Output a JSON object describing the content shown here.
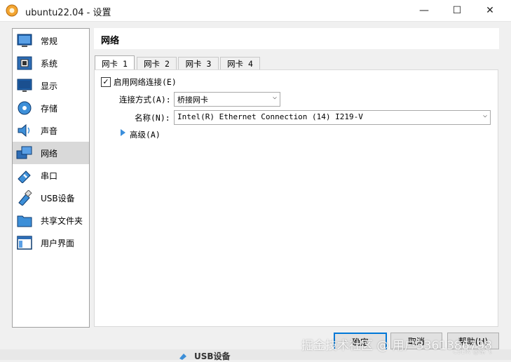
{
  "window": {
    "title": "ubuntu22.04 - 设置",
    "minimize_glyph": "—",
    "maximize_glyph": "☐",
    "close_glyph": "✕"
  },
  "sidebar": {
    "items": [
      {
        "label": "常规",
        "icon": "general-icon"
      },
      {
        "label": "系统",
        "icon": "system-icon"
      },
      {
        "label": "显示",
        "icon": "display-icon"
      },
      {
        "label": "存储",
        "icon": "storage-icon"
      },
      {
        "label": "声音",
        "icon": "audio-icon"
      },
      {
        "label": "网络",
        "icon": "network-icon",
        "selected": true
      },
      {
        "label": "串口",
        "icon": "serial-port-icon"
      },
      {
        "label": "USB设备",
        "icon": "usb-icon"
      },
      {
        "label": "共享文件夹",
        "icon": "shared-folder-icon"
      },
      {
        "label": "用户界面",
        "icon": "user-interface-icon"
      }
    ]
  },
  "page": {
    "title": "网络",
    "tabs": [
      "网卡 1",
      "网卡 2",
      "网卡 3",
      "网卡 4"
    ],
    "active_tab": 0,
    "enable_checkbox": {
      "label": "启用网络连接(E)",
      "checked": true,
      "mark": "✓"
    },
    "attached_to": {
      "label": "连接方式(A):",
      "value": "桥接网卡"
    },
    "name": {
      "label": "名称(N):",
      "value": "Intel(R) Ethernet Connection (14) I219-V"
    },
    "advanced": {
      "label": "高级(A)"
    },
    "chevron": "⌵"
  },
  "buttons": {
    "ok": "确定",
    "cancel": "取消",
    "help": "帮助(H)"
  },
  "background": {
    "partial_label": "USB设备"
  },
  "watermark": {
    "line1": "掘金技术社区 @ 用户3361386798",
    "line2": "CSDN @路飞"
  },
  "colors": {
    "accent": "#0078d7",
    "selected_item": "#d9d9d9",
    "advanced_arrow": "#3b8fdc"
  }
}
